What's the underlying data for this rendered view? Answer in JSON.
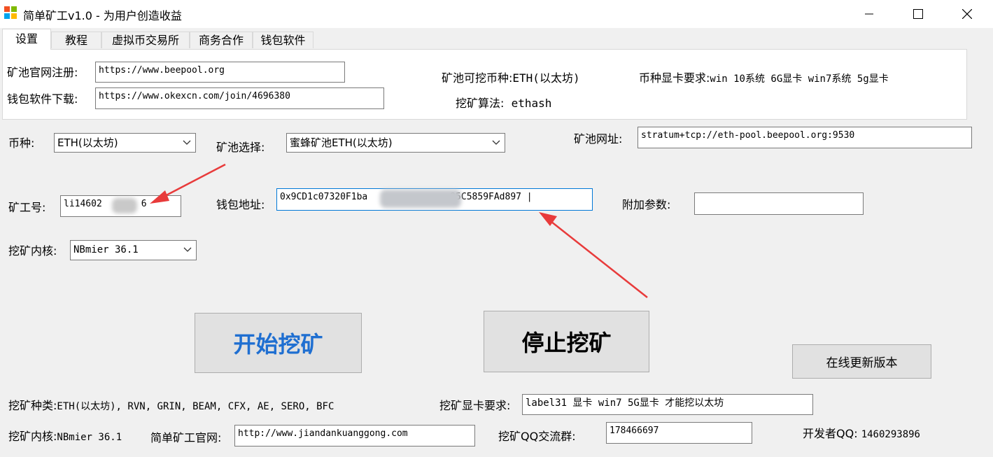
{
  "window": {
    "title": "简单矿工v1.0 -  为用户创造收益",
    "minimize_glyph": "—",
    "maximize_glyph": "☐",
    "close_glyph": "✕"
  },
  "tabs": [
    "设置",
    "教程",
    "虚拟币交易所",
    "商务合作",
    "钱包软件"
  ],
  "info_panel": {
    "pool_register_label": "矿池官网注册:",
    "pool_register_value": "https://www.beepool.org",
    "wallet_download_label": "钱包软件下载:",
    "wallet_download_value": "https://www.okexcn.com/join/4696380",
    "minable_coins_label": "矿池可挖币种:",
    "minable_coins_value": "ETH(以太坊)",
    "algo_label": "挖矿算法:",
    "algo_value": "ethash",
    "gpu_req_label": "币种显卡要求:",
    "gpu_req_value": "win 10系统 6G显卡  win7系统 5g显卡"
  },
  "form": {
    "coin_label": "币种:",
    "coin_value": "ETH(以太坊)",
    "pool_select_label": "矿池选择:",
    "pool_select_value": "蜜蜂矿池ETH(以太坊)",
    "pool_url_label": "矿池网址:",
    "pool_url_value": "stratum+tcp://eth-pool.beepool.org:9530",
    "worker_label": "矿工号:",
    "worker_value_prefix": "li14602",
    "worker_value_suffix": "6",
    "wallet_label": "钱包地址:",
    "wallet_value_prefix": "0x9CD1c07320F1ba",
    "wallet_value_suffix": "95C5859FAd897 |",
    "extra_params_label": "附加参数:",
    "extra_params_value": "",
    "kernel_label": "挖矿内核:",
    "kernel_value": "NBmier 36.1"
  },
  "buttons": {
    "start": "开始挖矿",
    "stop": "停止挖矿",
    "update": "在线更新版本"
  },
  "footer": {
    "kinds_label": "挖矿种类:",
    "kinds_value": "ETH(以太坊), RVN, GRIN, BEAM, CFX, AE, SERO, BFC",
    "gpu_label": "挖矿显卡要求:",
    "gpu_value": "label31 显卡  win7 5G显卡  才能挖以太坊",
    "kernel_label": "挖矿内核:",
    "kernel_value": "NBmier 36.1",
    "site_label": "简单矿工官网:",
    "site_value": "http://www.jiandankuanggong.com",
    "qq_group_label": "挖矿QQ交流群:",
    "qq_group_value": "178466697",
    "dev_qq_label": "开发者QQ:",
    "dev_qq_value": "1460293896"
  },
  "colors": {
    "start_text": "#1f6fd1",
    "stop_text": "#000000",
    "arrow": "#e83b3b"
  }
}
